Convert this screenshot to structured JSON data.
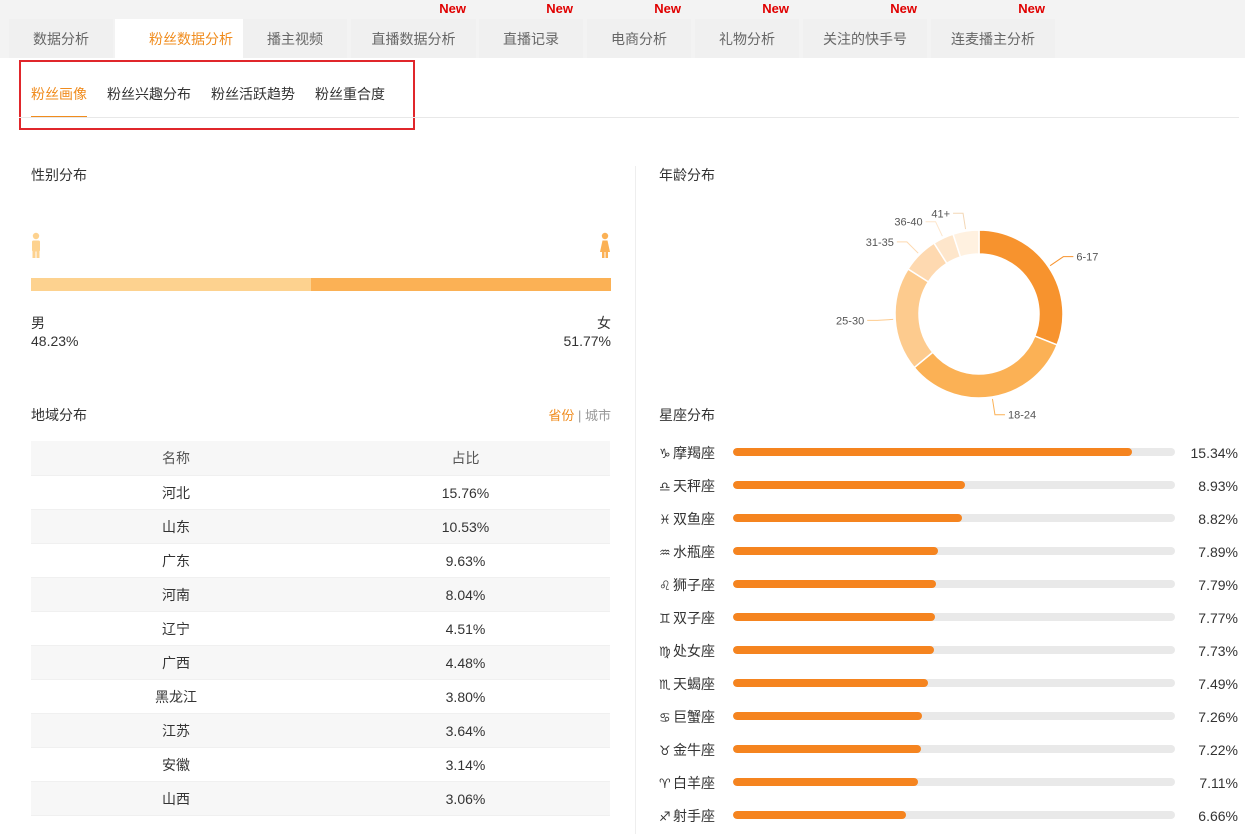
{
  "top_tabs": [
    {
      "label": "数据分析",
      "active": false,
      "badge": ""
    },
    {
      "label": "粉丝数据分析",
      "active": true,
      "badge": ""
    },
    {
      "label": "播主视频",
      "active": false,
      "badge": ""
    },
    {
      "label": "直播数据分析",
      "active": false,
      "badge": "New"
    },
    {
      "label": "直播记录",
      "active": false,
      "badge": "New"
    },
    {
      "label": "电商分析",
      "active": false,
      "badge": "New"
    },
    {
      "label": "礼物分析",
      "active": false,
      "badge": "New"
    },
    {
      "label": "关注的快手号",
      "active": false,
      "badge": "New"
    },
    {
      "label": "连麦播主分析",
      "active": false,
      "badge": "New"
    }
  ],
  "sub_tabs": [
    {
      "label": "粉丝画像",
      "active": true
    },
    {
      "label": "粉丝兴趣分布",
      "active": false
    },
    {
      "label": "粉丝活跃趋势",
      "active": false
    },
    {
      "label": "粉丝重合度",
      "active": false
    }
  ],
  "gender": {
    "title": "性别分布",
    "male_label": "男",
    "female_label": "女",
    "male_pct_text": "48.23%",
    "female_pct_text": "51.77%",
    "male_value": 48.23,
    "female_value": 51.77,
    "male_color": "#fdd28f",
    "female_color": "#fbb155"
  },
  "region": {
    "title": "地域分布",
    "toggle_province": "省份",
    "toggle_sep": " | ",
    "toggle_city": "城市",
    "columns": [
      "名称",
      "占比"
    ],
    "rows": [
      [
        "河北",
        "15.76%"
      ],
      [
        "山东",
        "10.53%"
      ],
      [
        "广东",
        "9.63%"
      ],
      [
        "河南",
        "8.04%"
      ],
      [
        "辽宁",
        "4.51%"
      ],
      [
        "广西",
        "4.48%"
      ],
      [
        "黑龙江",
        "3.80%"
      ],
      [
        "江苏",
        "3.64%"
      ],
      [
        "安徽",
        "3.14%"
      ],
      [
        "山西",
        "3.06%"
      ]
    ]
  },
  "age": {
    "title": "年龄分布",
    "segments": [
      {
        "label": "6-17",
        "value": 31,
        "color": "#f7932e"
      },
      {
        "label": "18-24",
        "value": 33,
        "color": "#fbb155"
      },
      {
        "label": "25-30",
        "value": 20,
        "color": "#fdcb8e"
      },
      {
        "label": "31-35",
        "value": 7,
        "color": "#fed9b0"
      },
      {
        "label": "36-40",
        "value": 4,
        "color": "#fee6cb"
      },
      {
        "label": "41+",
        "value": 5,
        "color": "#fff1e0"
      }
    ]
  },
  "zodiac": {
    "title": "星座分布",
    "bar_color": "#f5841f",
    "items": [
      {
        "icon": "capricorn-icon",
        "symbol": "♑",
        "name": "摩羯座",
        "pct_text": "15.34%",
        "value": 15.34
      },
      {
        "icon": "libra-icon",
        "symbol": "♎",
        "name": "天秤座",
        "pct_text": "8.93%",
        "value": 8.93
      },
      {
        "icon": "pisces-icon",
        "symbol": "♓",
        "name": "双鱼座",
        "pct_text": "8.82%",
        "value": 8.82
      },
      {
        "icon": "aquarius-icon",
        "symbol": "♒",
        "name": "水瓶座",
        "pct_text": "7.89%",
        "value": 7.89
      },
      {
        "icon": "leo-icon",
        "symbol": "♌",
        "name": "狮子座",
        "pct_text": "7.79%",
        "value": 7.79
      },
      {
        "icon": "gemini-icon",
        "symbol": "♊",
        "name": "双子座",
        "pct_text": "7.77%",
        "value": 7.77
      },
      {
        "icon": "virgo-icon",
        "symbol": "♍",
        "name": "处女座",
        "pct_text": "7.73%",
        "value": 7.73
      },
      {
        "icon": "scorpio-icon",
        "symbol": "♏",
        "name": "天蝎座",
        "pct_text": "7.49%",
        "value": 7.49
      },
      {
        "icon": "cancer-icon",
        "symbol": "♋",
        "name": "巨蟹座",
        "pct_text": "7.26%",
        "value": 7.26
      },
      {
        "icon": "taurus-icon",
        "symbol": "♉",
        "name": "金牛座",
        "pct_text": "7.22%",
        "value": 7.22
      },
      {
        "icon": "aries-icon",
        "symbol": "♈",
        "name": "白羊座",
        "pct_text": "7.11%",
        "value": 7.11
      },
      {
        "icon": "sagittarius-icon",
        "symbol": "♐",
        "name": "射手座",
        "pct_text": "6.66%",
        "value": 6.66
      }
    ]
  }
}
